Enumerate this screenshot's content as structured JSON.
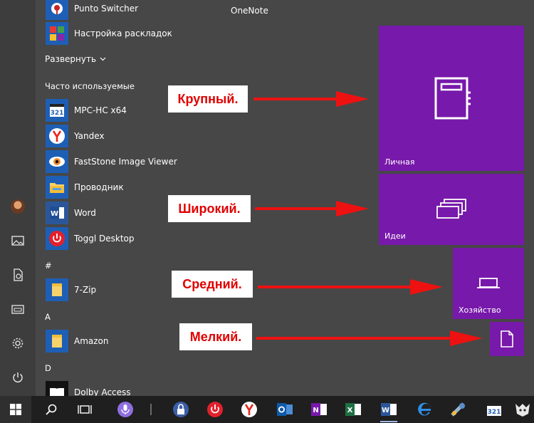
{
  "start": {
    "apps": [
      {
        "label": "Punto Switcher",
        "icon": "punto-switcher-icon"
      },
      {
        "label": "Настройка раскладок",
        "icon": "layout-settings-icon"
      },
      {
        "label": "MPC-HC x64",
        "icon": "mpc-hc-icon"
      },
      {
        "label": "Yandex",
        "icon": "yandex-icon"
      },
      {
        "label": "FastStone Image Viewer",
        "icon": "faststone-icon"
      },
      {
        "label": "Проводник",
        "icon": "folder-icon"
      },
      {
        "label": "Word",
        "icon": "word-icon"
      },
      {
        "label": "Toggl Desktop",
        "icon": "toggl-icon"
      },
      {
        "label": "7-Zip",
        "icon": "folder-icon"
      },
      {
        "label": "Amazon",
        "icon": "folder-icon"
      },
      {
        "label": "Dolby Access",
        "icon": "dolby-icon"
      }
    ],
    "expand_label": "Развернуть",
    "frequent_header": "Часто используемые",
    "section_hash": "#",
    "section_a": "A",
    "section_d": "D"
  },
  "tiles": {
    "group_title": "OneNote",
    "large": {
      "label": "Личная",
      "color": "#7719aa"
    },
    "wide": {
      "label": "Идеи",
      "color": "#7719aa"
    },
    "medium": {
      "label": "Хозяйство",
      "color": "#7719aa"
    },
    "small": {
      "label": ""
    }
  },
  "annotations": {
    "large": "Крупный.",
    "wide": "Широкий.",
    "medium": "Средний.",
    "small": "Мелкий.",
    "arrow_color": "#ee1111"
  },
  "rail": {
    "icons": [
      "avatar",
      "pictures-icon",
      "documents-icon",
      "file-explorer-icon",
      "gear-icon",
      "power-icon"
    ]
  },
  "taskbar": {
    "icons": [
      "windows-start-icon",
      "search-icon",
      "task-view-icon",
      "cortana-mic-icon",
      "keepass-icon",
      "toggl-icon",
      "yandex-icon",
      "outlook-icon",
      "onenote-icon",
      "excel-icon",
      "word-icon",
      "edge-icon",
      "faststone-icon",
      "mpc-hc-icon",
      "media-player-icon"
    ]
  }
}
